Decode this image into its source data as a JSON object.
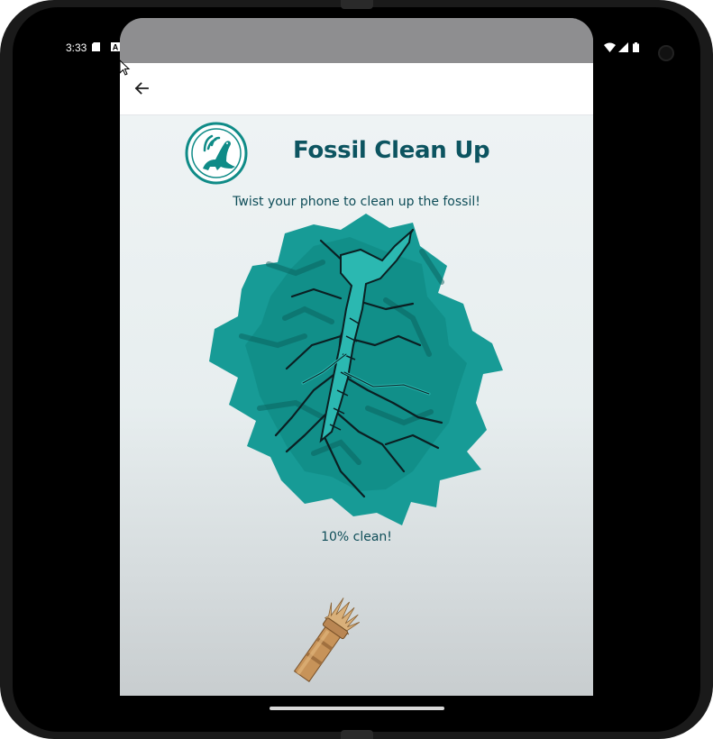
{
  "statusbar": {
    "time": "3:33",
    "icons": [
      "sd-card-icon",
      "a-icon",
      "shield-icon",
      "wifi-icon",
      "signal-icon",
      "battery-icon"
    ]
  },
  "appbar": {
    "back_icon": "arrow-back-icon"
  },
  "screen": {
    "title": "Fossil Clean Up",
    "subtitle": "Twist your phone to clean up the fossil!",
    "progress_text": "10% clean!",
    "progress_fraction": 0.1
  },
  "colors": {
    "accent": "#0c5460",
    "teal": "#179b96",
    "teal_dark": "#0d7f7b",
    "appbar_bg": "#ffffff"
  }
}
